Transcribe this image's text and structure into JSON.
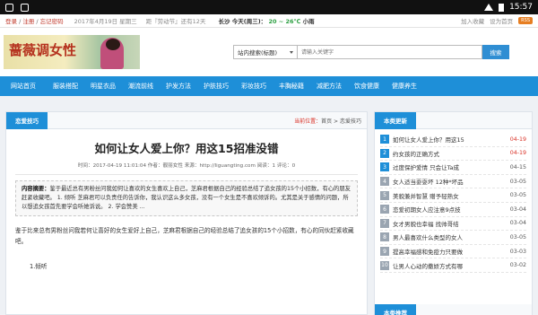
{
  "statusbar": {
    "time": "15:57"
  },
  "topbar": {
    "links": [
      "登录",
      "注册",
      "忘记密码"
    ],
    "date": "2017年4月19日 星期三",
    "festival": "距『劳动节』还有12天",
    "city": "长沙",
    "weather_label": "今天(周三)：",
    "temp": "20 ~ 26℃",
    "weather_desc": "小雨",
    "actions": [
      "加入收藏",
      "设为首页"
    ],
    "rss": "RSS"
  },
  "header": {
    "logo_text": "蔷薇调女性",
    "search_scope": "站内搜索(标题)",
    "search_placeholder": "请输入关键字",
    "search_button": "搜索"
  },
  "nav": [
    "网站首页",
    "服装搭配",
    "明星衣品",
    "潮流前线",
    "护发方法",
    "护肤技巧",
    "彩妆技巧",
    "丰胸秘籍",
    "减肥方法",
    "饮食健康",
    "健康养生"
  ],
  "article": {
    "category_tab": "恋爱技巧",
    "breadcrumb_label": "当前位置：",
    "breadcrumb_home": "首页",
    "breadcrumb_sep": ">",
    "breadcrumb_cat": "恋爱技巧",
    "title": "如何让女人爱上你？用这15招准没错",
    "meta": "时间：2017-04-19 11:01:04 作者：靓丽女性 来源：http://liguangting.com 阅读：1 评论：0",
    "summary_label": "内容摘要：",
    "summary_text": "鉴于最近总有男粉丝问我如何让喜欢的女生喜欢上自己，芝麻君根据自己的经验总结了追女孩的15个小招数，有心的朋友赶紧收藏吧。 1. 倾听 芝麻君可以负责任的告诉你，我认识这么多女孩，没有一个女生是不喜欢倾诉的。尤其是关于感情的问题，所以想追女孩首先要学会听她诉说。 2. 学会赞美 ...",
    "para1": "鉴于比来总有男粉丝问我若何让喜好的女生爱好上自己，芝麻君根据自己的经验总结了追女孩的15个小招数，有心的同伙赶紧收藏吧。",
    "para2": "1.倾听"
  },
  "sidebar": {
    "head": "本类更新",
    "items": [
      {
        "num": "1",
        "title": "如何让女人爱上你？用这15",
        "date": "04-19",
        "red": true
      },
      {
        "num": "2",
        "title": "约女孩的正确方式",
        "date": "04-19",
        "red": true
      },
      {
        "num": "3",
        "title": "过度保护爱情 只会让Ta成",
        "date": "04-15",
        "red": false
      },
      {
        "num": "4",
        "title": "女人适当耍耍坏 12种*坏品",
        "date": "03-05",
        "red": false
      },
      {
        "num": "5",
        "title": "美貌兼并智慧 赠予轻熟女",
        "date": "03-05",
        "red": false
      },
      {
        "num": "6",
        "title": "恋爱初期女人应注意9点技",
        "date": "03-04",
        "red": false
      },
      {
        "num": "7",
        "title": "女才男貌也幸福 找帅哥结",
        "date": "03-04",
        "red": false
      },
      {
        "num": "8",
        "title": "男人最喜欢什么类型的女人",
        "date": "03-05",
        "red": false
      },
      {
        "num": "9",
        "title": "提高幸福感和免疫力只要做",
        "date": "03-03",
        "red": false
      },
      {
        "num": "10",
        "title": "让男人心动的撒娇方式有哪",
        "date": "03-02",
        "red": false
      }
    ],
    "head2": "本类推荐"
  }
}
